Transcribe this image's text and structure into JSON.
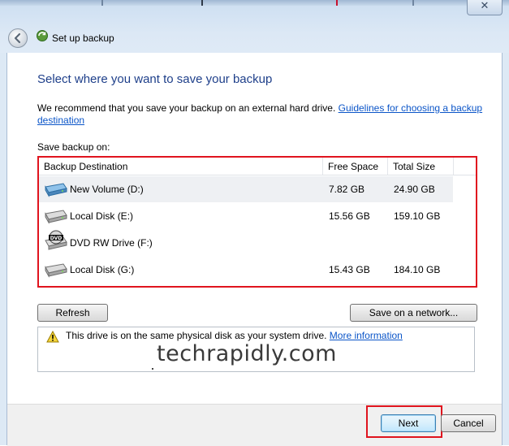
{
  "window": {
    "title": "Set up backup",
    "close_glyph": "✕"
  },
  "main": {
    "heading": "Select where you want to save your backup",
    "recommend_text": "We recommend that you save your backup on an external hard drive. ",
    "guidelines_link": "Guidelines for choosing a backup destination",
    "save_label": "Save backup on:"
  },
  "table": {
    "columns": [
      "Backup Destination",
      "Free Space",
      "Total Size"
    ],
    "rows": [
      {
        "name": "New Volume (D:)",
        "free": "7.82 GB",
        "total": "24.90 GB",
        "icon": "hard-drive-icon",
        "selected": true
      },
      {
        "name": "Local Disk (E:)",
        "free": "15.56 GB",
        "total": "159.10 GB",
        "icon": "hard-drive-icon",
        "selected": false
      },
      {
        "name": "DVD RW Drive (F:)",
        "free": "",
        "total": "",
        "icon": "dvd-drive-icon",
        "selected": false
      },
      {
        "name": "Local Disk (G:)",
        "free": "15.43 GB",
        "total": "184.10 GB",
        "icon": "hard-drive-icon",
        "selected": false
      }
    ]
  },
  "buttons": {
    "refresh": "Refresh",
    "save_network": "Save on a network...",
    "next": "Next",
    "cancel": "Cancel"
  },
  "info": {
    "text": "This drive is on the same physical disk as your system drive. ",
    "more_link": "More information"
  },
  "watermark": "techrapidly.com",
  "colors": {
    "heading": "#1e3f8a",
    "link": "#0b55c8",
    "highlight": "#e0141e"
  }
}
